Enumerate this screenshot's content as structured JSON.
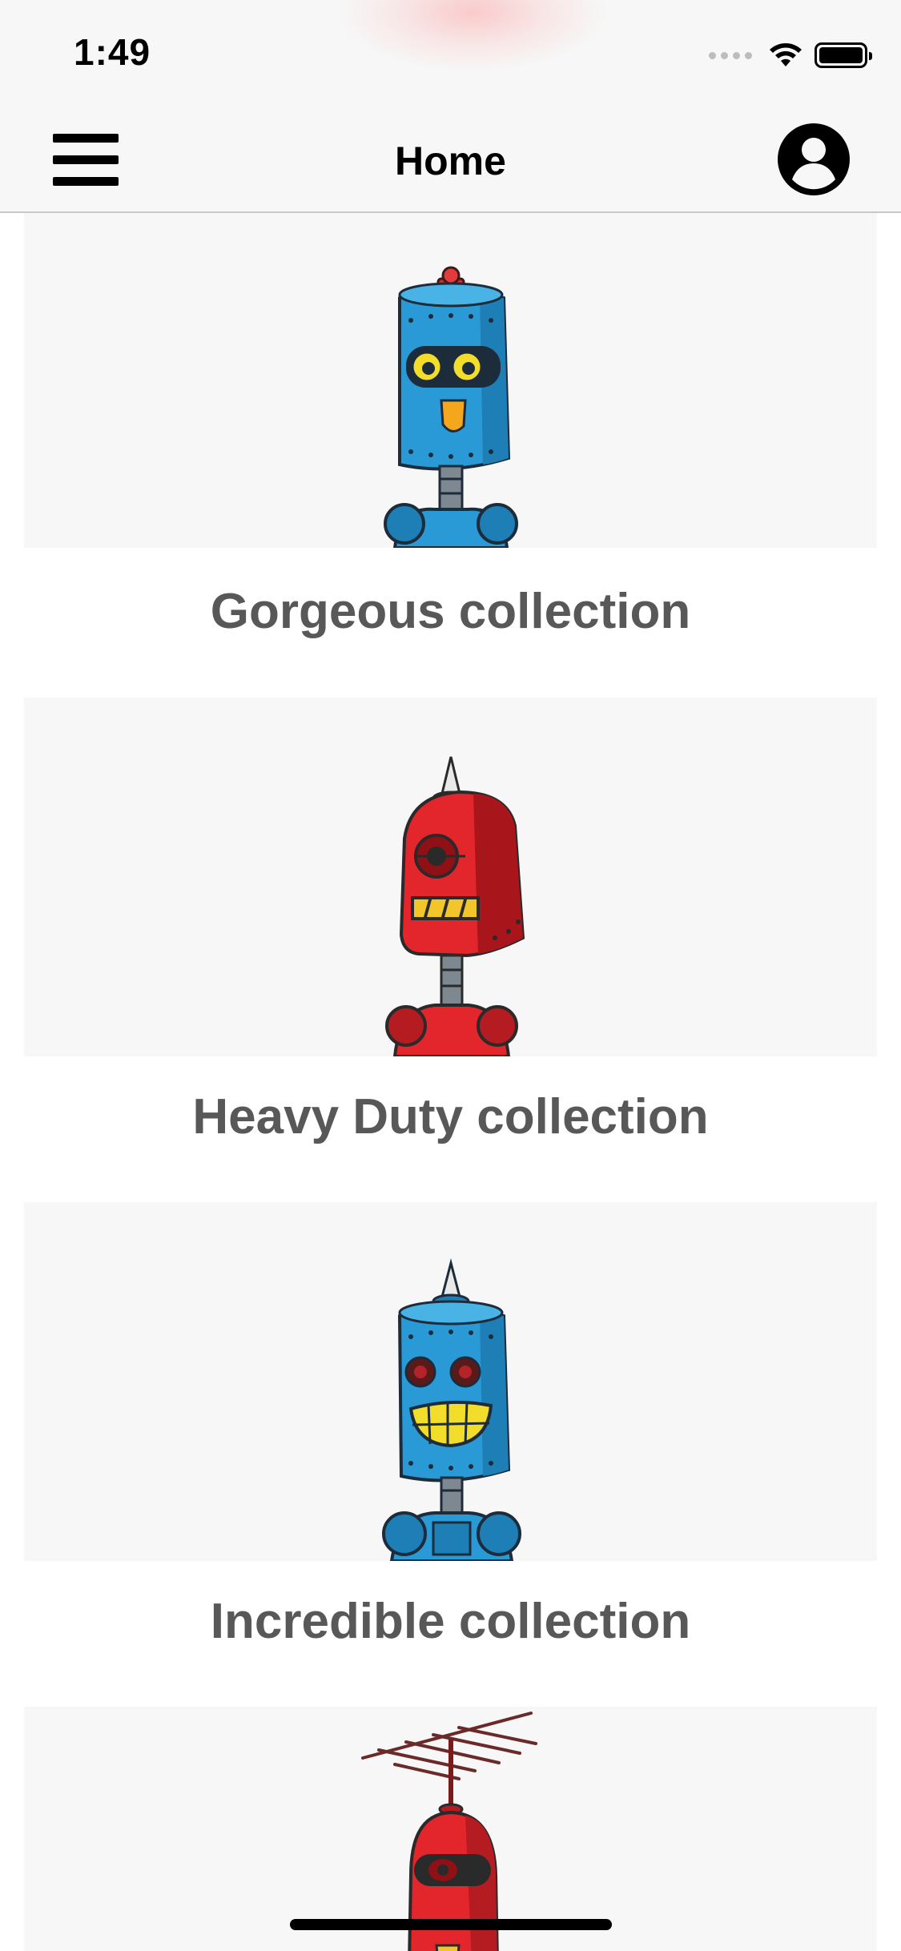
{
  "status_bar": {
    "time": "1:49",
    "icons": [
      "cellular-signal-icon",
      "wifi-icon",
      "battery-icon"
    ]
  },
  "nav": {
    "title": "Home",
    "left_icon": "hamburger-menu-icon",
    "right_icon": "account-circle-icon"
  },
  "collections": [
    {
      "title": "Gorgeous collection",
      "image": "blue-robot-yellow-eyes-illustration"
    },
    {
      "title": "Heavy Duty collection",
      "image": "red-robot-cyclops-illustration"
    },
    {
      "title": "Incredible collection",
      "image": "blue-robot-grin-illustration"
    },
    {
      "title": "",
      "image": "red-robot-antenna-illustration"
    }
  ],
  "colors": {
    "nav_background": "#f7f7f7",
    "card_background": "#f7f7f7",
    "title_text": "#585858",
    "robot_blue": "#2a9ad6",
    "robot_red": "#e3262c"
  }
}
